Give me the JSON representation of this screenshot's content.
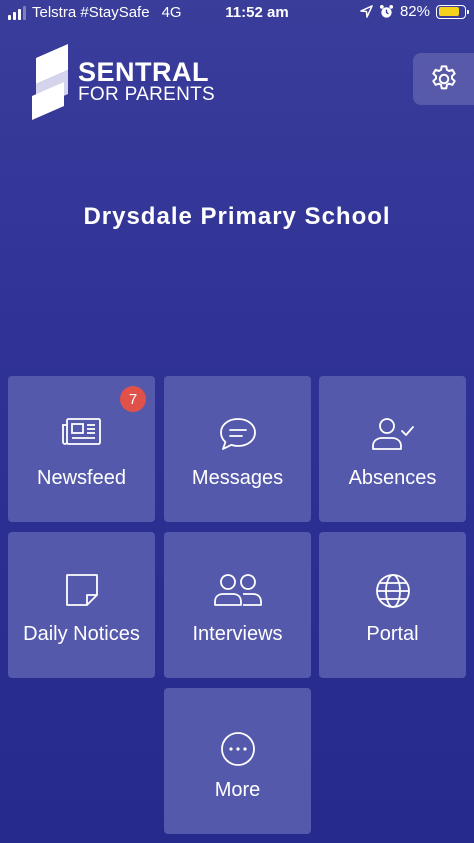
{
  "status_bar": {
    "carrier": "Telstra #StaySafe",
    "network": "4G",
    "time": "11:52 am",
    "battery_percent": "82%",
    "battery_level": 0.82,
    "battery_color": "#f5d21c"
  },
  "header": {
    "logo_line1": "SENTRAL",
    "logo_line2": "FOR PARENTS",
    "settings_icon": "gear-icon"
  },
  "school_name": "Drysdale Primary School",
  "tiles": [
    {
      "label": "Newsfeed",
      "icon": "newspaper-icon",
      "badge": "7"
    },
    {
      "label": "Messages",
      "icon": "chat-icon"
    },
    {
      "label": "Absences",
      "icon": "user-check-icon"
    },
    {
      "label": "Daily Notices",
      "icon": "note-icon"
    },
    {
      "label": "Interviews",
      "icon": "users-icon"
    },
    {
      "label": "Portal",
      "icon": "globe-icon"
    },
    {
      "label": "More",
      "icon": "more-icon"
    }
  ],
  "colors": {
    "background": "#303296",
    "tile": "#5559ab",
    "badge": "#e05249"
  }
}
